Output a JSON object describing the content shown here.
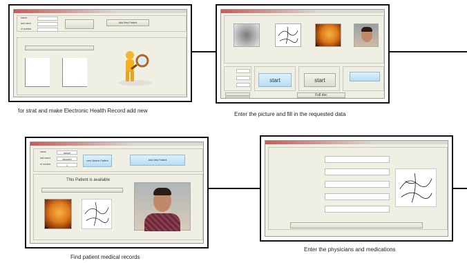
{
  "captions": {
    "step1": "for strat and make Electronic Health Record add new",
    "step2": "Enter the picture and fill in the requested data",
    "step3": "Find patient medical records",
    "step4": "Enter the physicians and medications"
  },
  "step1_window": {
    "fields": [
      "Name",
      "last name",
      "id number"
    ],
    "buttons": {
      "add": "Add New Patient"
    }
  },
  "step2_window": {
    "buttons": {
      "start1": "start",
      "start2": "start",
      "full_doc": "Full doc"
    }
  },
  "step3_window": {
    "fields": [
      {
        "label": "name",
        "value": "farhad"
      },
      {
        "label": "last name",
        "value": "Alizadeh"
      },
      {
        "label": "id number",
        "value": "1"
      }
    ],
    "buttons": {
      "search": "new Search Patient",
      "add": "Add New Patient"
    },
    "status": "This Patient is available"
  }
}
